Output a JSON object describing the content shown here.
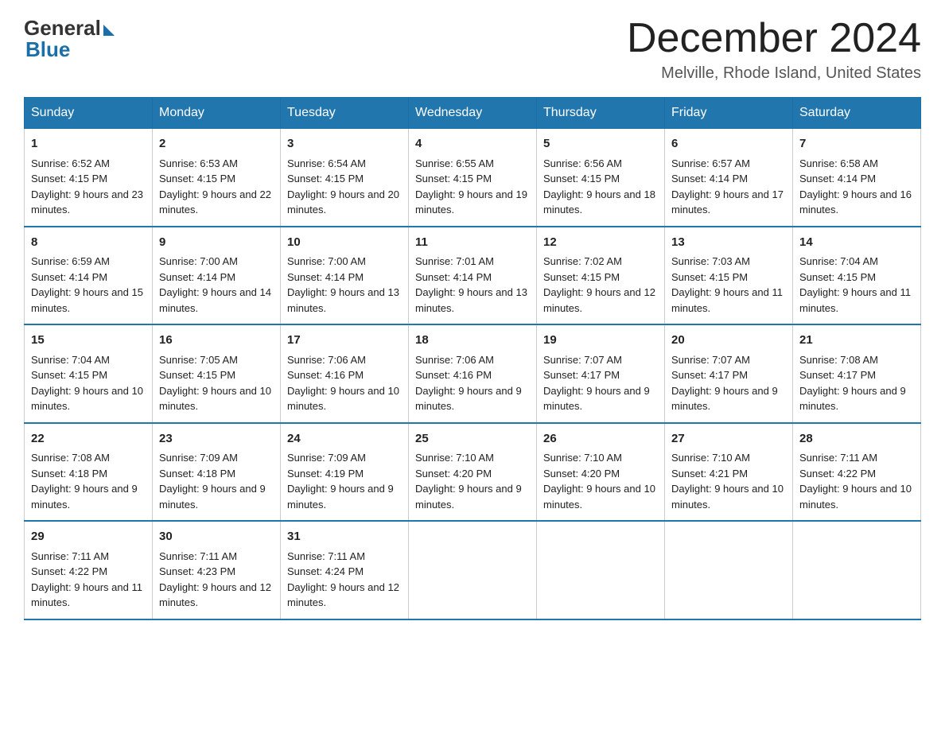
{
  "header": {
    "logo_general": "General",
    "logo_blue": "Blue",
    "month_title": "December 2024",
    "location": "Melville, Rhode Island, United States"
  },
  "days_of_week": [
    "Sunday",
    "Monday",
    "Tuesday",
    "Wednesday",
    "Thursday",
    "Friday",
    "Saturday"
  ],
  "weeks": [
    [
      {
        "day": "1",
        "sunrise": "6:52 AM",
        "sunset": "4:15 PM",
        "daylight": "9 hours and 23 minutes."
      },
      {
        "day": "2",
        "sunrise": "6:53 AM",
        "sunset": "4:15 PM",
        "daylight": "9 hours and 22 minutes."
      },
      {
        "day": "3",
        "sunrise": "6:54 AM",
        "sunset": "4:15 PM",
        "daylight": "9 hours and 20 minutes."
      },
      {
        "day": "4",
        "sunrise": "6:55 AM",
        "sunset": "4:15 PM",
        "daylight": "9 hours and 19 minutes."
      },
      {
        "day": "5",
        "sunrise": "6:56 AM",
        "sunset": "4:15 PM",
        "daylight": "9 hours and 18 minutes."
      },
      {
        "day": "6",
        "sunrise": "6:57 AM",
        "sunset": "4:14 PM",
        "daylight": "9 hours and 17 minutes."
      },
      {
        "day": "7",
        "sunrise": "6:58 AM",
        "sunset": "4:14 PM",
        "daylight": "9 hours and 16 minutes."
      }
    ],
    [
      {
        "day": "8",
        "sunrise": "6:59 AM",
        "sunset": "4:14 PM",
        "daylight": "9 hours and 15 minutes."
      },
      {
        "day": "9",
        "sunrise": "7:00 AM",
        "sunset": "4:14 PM",
        "daylight": "9 hours and 14 minutes."
      },
      {
        "day": "10",
        "sunrise": "7:00 AM",
        "sunset": "4:14 PM",
        "daylight": "9 hours and 13 minutes."
      },
      {
        "day": "11",
        "sunrise": "7:01 AM",
        "sunset": "4:14 PM",
        "daylight": "9 hours and 13 minutes."
      },
      {
        "day": "12",
        "sunrise": "7:02 AM",
        "sunset": "4:15 PM",
        "daylight": "9 hours and 12 minutes."
      },
      {
        "day": "13",
        "sunrise": "7:03 AM",
        "sunset": "4:15 PM",
        "daylight": "9 hours and 11 minutes."
      },
      {
        "day": "14",
        "sunrise": "7:04 AM",
        "sunset": "4:15 PM",
        "daylight": "9 hours and 11 minutes."
      }
    ],
    [
      {
        "day": "15",
        "sunrise": "7:04 AM",
        "sunset": "4:15 PM",
        "daylight": "9 hours and 10 minutes."
      },
      {
        "day": "16",
        "sunrise": "7:05 AM",
        "sunset": "4:15 PM",
        "daylight": "9 hours and 10 minutes."
      },
      {
        "day": "17",
        "sunrise": "7:06 AM",
        "sunset": "4:16 PM",
        "daylight": "9 hours and 10 minutes."
      },
      {
        "day": "18",
        "sunrise": "7:06 AM",
        "sunset": "4:16 PM",
        "daylight": "9 hours and 9 minutes."
      },
      {
        "day": "19",
        "sunrise": "7:07 AM",
        "sunset": "4:17 PM",
        "daylight": "9 hours and 9 minutes."
      },
      {
        "day": "20",
        "sunrise": "7:07 AM",
        "sunset": "4:17 PM",
        "daylight": "9 hours and 9 minutes."
      },
      {
        "day": "21",
        "sunrise": "7:08 AM",
        "sunset": "4:17 PM",
        "daylight": "9 hours and 9 minutes."
      }
    ],
    [
      {
        "day": "22",
        "sunrise": "7:08 AM",
        "sunset": "4:18 PM",
        "daylight": "9 hours and 9 minutes."
      },
      {
        "day": "23",
        "sunrise": "7:09 AM",
        "sunset": "4:18 PM",
        "daylight": "9 hours and 9 minutes."
      },
      {
        "day": "24",
        "sunrise": "7:09 AM",
        "sunset": "4:19 PM",
        "daylight": "9 hours and 9 minutes."
      },
      {
        "day": "25",
        "sunrise": "7:10 AM",
        "sunset": "4:20 PM",
        "daylight": "9 hours and 9 minutes."
      },
      {
        "day": "26",
        "sunrise": "7:10 AM",
        "sunset": "4:20 PM",
        "daylight": "9 hours and 10 minutes."
      },
      {
        "day": "27",
        "sunrise": "7:10 AM",
        "sunset": "4:21 PM",
        "daylight": "9 hours and 10 minutes."
      },
      {
        "day": "28",
        "sunrise": "7:11 AM",
        "sunset": "4:22 PM",
        "daylight": "9 hours and 10 minutes."
      }
    ],
    [
      {
        "day": "29",
        "sunrise": "7:11 AM",
        "sunset": "4:22 PM",
        "daylight": "9 hours and 11 minutes."
      },
      {
        "day": "30",
        "sunrise": "7:11 AM",
        "sunset": "4:23 PM",
        "daylight": "9 hours and 12 minutes."
      },
      {
        "day": "31",
        "sunrise": "7:11 AM",
        "sunset": "4:24 PM",
        "daylight": "9 hours and 12 minutes."
      },
      null,
      null,
      null,
      null
    ]
  ],
  "labels": {
    "sunrise": "Sunrise:",
    "sunset": "Sunset:",
    "daylight": "Daylight:"
  }
}
